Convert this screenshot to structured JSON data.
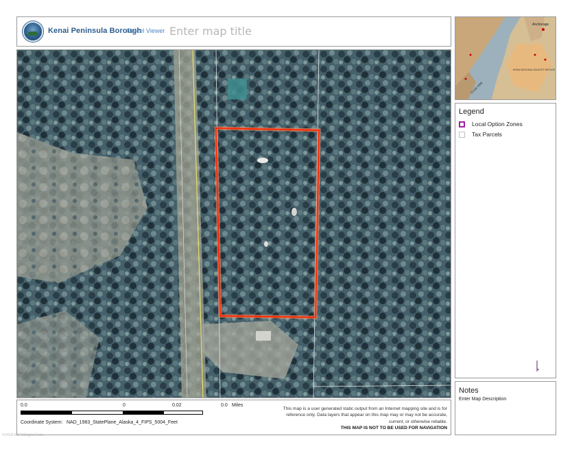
{
  "header": {
    "org_name": "Kenai Peninsula Borough",
    "app_name": "Parcel Viewer",
    "map_title_placeholder": "Enter map title",
    "logo_icon": "kpb-seal-icon"
  },
  "map": {
    "basemap": "aerial imagery",
    "highlight_color": "#ff2a00",
    "road_line_color": "#e8e26a",
    "parcel_line_color": "#e9e9e9"
  },
  "scale": {
    "labels": [
      "0.0",
      "0",
      "0.02",
      "0.0"
    ],
    "unit": "Miles",
    "colors": [
      "#000000",
      "#ffffff"
    ]
  },
  "coordinate_system": {
    "label": "Coordinate System:",
    "value": "NAD_1983_StatePlane_Alaska_4_FIPS_5004_Feet"
  },
  "disclaimer": {
    "line1": "This map is a user generated static output from an Internet mapping site and is for",
    "line2": "reference only. Data layers that appear on this map may or may not be accurate,",
    "line3": "current, or otherwise reliable.",
    "warning": "THIS MAP IS NOT TO BE USED FOR NAVIGATION"
  },
  "overview": {
    "labels": [
      "Anchorage",
      "Cook Inlet",
      "KENAI NATIONAL WILDLIFE REFUGE"
    ],
    "water_color": "#9db1bd",
    "land_color": "#c9a77a",
    "refuge_color": "#e8b97e"
  },
  "legend": {
    "title": "Legend",
    "items": [
      {
        "label": "Local Option Zones",
        "color": "#a020a0"
      },
      {
        "label": "Tax Parcels",
        "color": "#c8c8c8"
      }
    ],
    "north_icon": "north-arrow-icon"
  },
  "notes": {
    "title": "Notes",
    "text": "Enter Map Description"
  },
  "watermark": "©2018 ESRI/DigitalGlobe"
}
